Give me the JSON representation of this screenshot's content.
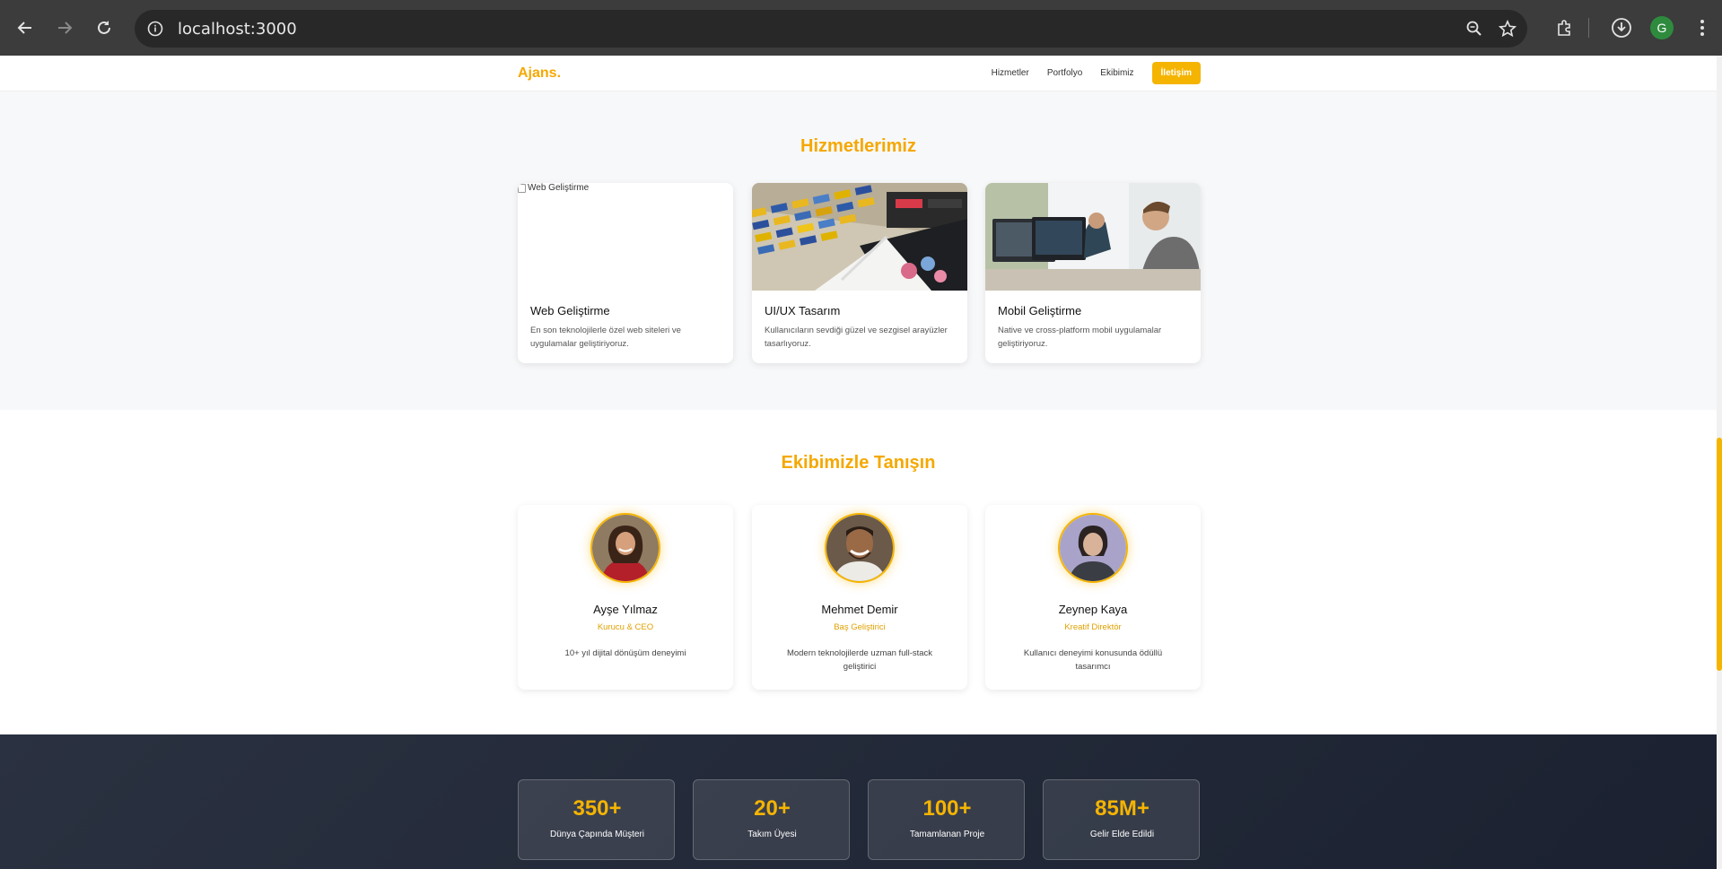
{
  "browser": {
    "url": "localhost:3000",
    "profile_initial": "G"
  },
  "nav": {
    "logo": "Ajans.",
    "links": [
      "Hizmetler",
      "Portfolyo",
      "Ekibimiz"
    ],
    "cta": "İletişim"
  },
  "services": {
    "title": "Hizmetlerimiz",
    "items": [
      {
        "title": "Web Geliştirme",
        "description": "En son teknolojilerle özel web siteleri ve uygulamalar geliştiriyoruz.",
        "image_alt": "Web Geliştirme"
      },
      {
        "title": "UI/UX Tasarım",
        "description": "Kullanıcıların sevdiği güzel ve sezgisel arayüzler tasarlıyoruz."
      },
      {
        "title": "Mobil Geliştirme",
        "description": "Native ve cross-platform mobil uygulamalar geliştiriyoruz."
      }
    ]
  },
  "team": {
    "title": "Ekibimizle Tanışın",
    "members": [
      {
        "name": "Ayşe Yılmaz",
        "role": "Kurucu & CEO",
        "description": "10+ yıl dijital dönüşüm deneyimi"
      },
      {
        "name": "Mehmet Demir",
        "role": "Baş Geliştirici",
        "description": "Modern teknolojilerde uzman full-stack geliştirici"
      },
      {
        "name": "Zeynep Kaya",
        "role": "Kreatif Direktör",
        "description": "Kullanıcı deneyimi konusunda ödüllü tasarımcı"
      }
    ]
  },
  "stats": [
    {
      "value": "350+",
      "label": "Dünya Çapında Müşteri"
    },
    {
      "value": "20+",
      "label": "Takım Üyesi"
    },
    {
      "value": "100+",
      "label": "Tamamlanan Proje"
    },
    {
      "value": "85M+",
      "label": "Gelir Elde Edildi"
    }
  ],
  "colors": {
    "accent": "#f5b400",
    "dark_band": "#232a38"
  }
}
